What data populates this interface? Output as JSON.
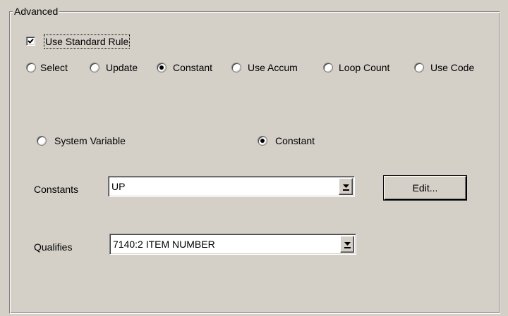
{
  "group": {
    "title": "Advanced"
  },
  "use_standard_rule": {
    "label": "Use Standard Rule",
    "checked": true
  },
  "rule_types": [
    {
      "label": "Select",
      "checked": false
    },
    {
      "label": "Update",
      "checked": false
    },
    {
      "label": "Constant",
      "checked": true
    },
    {
      "label": "Use Accum",
      "checked": false
    },
    {
      "label": "Loop Count",
      "checked": false
    },
    {
      "label": "Use Code",
      "checked": false
    }
  ],
  "source_types": [
    {
      "label": "System Variable",
      "checked": false
    },
    {
      "label": "Constant",
      "checked": true
    }
  ],
  "constants": {
    "label": "Constants",
    "value": "UP",
    "edit_label": "Edit..."
  },
  "qualifies": {
    "label": "Qualifies",
    "value": "7140:2 ITEM NUMBER"
  }
}
